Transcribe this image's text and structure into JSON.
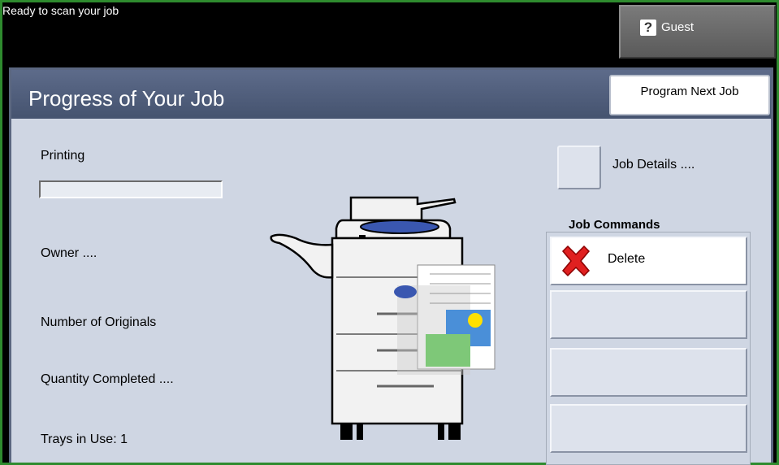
{
  "status_bar": {
    "message": "Ready to scan your job",
    "user_label": "Guest",
    "help_glyph": "?"
  },
  "header": {
    "title": "Progress of Your Job",
    "program_next_label": "Program Next Job"
  },
  "job_info": {
    "printing_label": "Printing",
    "progress": 0,
    "owner_label": "Owner ....",
    "originals_label": "Number of Originals",
    "quantity_label": "Quantity Completed ....",
    "trays_label": "Trays in Use: 1"
  },
  "job_details": {
    "label": "Job Details ...."
  },
  "job_commands": {
    "title": "Job Commands",
    "delete_label": "Delete"
  },
  "colors": {
    "header_bg": "#4d5b7a",
    "panel_bg": "#cfd6e3",
    "frame": "#2e8b2e"
  }
}
